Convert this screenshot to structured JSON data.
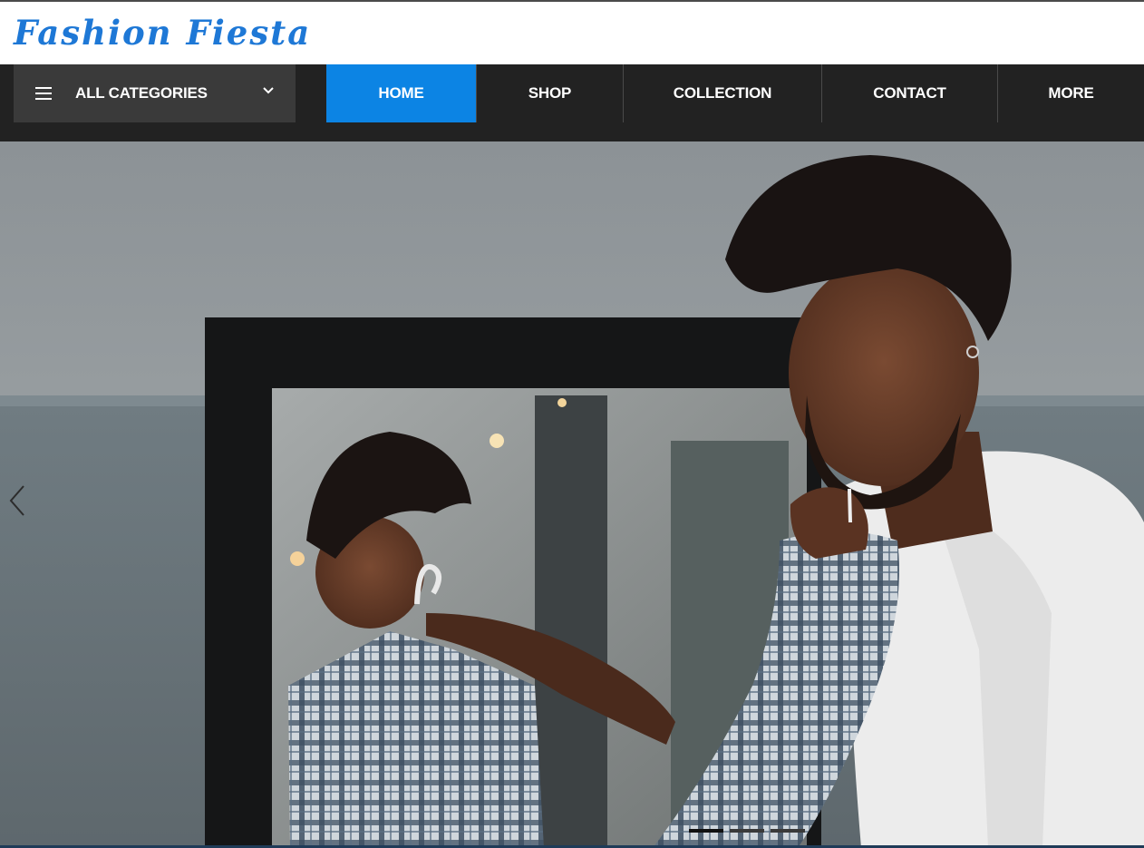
{
  "header": {
    "logo_text": "Fashion Fiesta",
    "logo_color": "#1e78d6"
  },
  "nav": {
    "category_toggle": {
      "label": "ALL CATEGORIES",
      "icon": "hamburger-menu-icon",
      "dropdown_icon": "chevron-down-icon"
    },
    "items": [
      {
        "label": "HOME",
        "active": true
      },
      {
        "label": "SHOP",
        "active": false
      },
      {
        "label": "COLLECTION",
        "active": false
      },
      {
        "label": "CONTACT",
        "active": false
      },
      {
        "label": "MORE",
        "active": false
      }
    ],
    "active_color": "#0c84e4",
    "bar_color": "#222222"
  },
  "hero": {
    "prev_icon": "chevron-left-icon",
    "slide_count": 3,
    "active_slide": 1
  }
}
